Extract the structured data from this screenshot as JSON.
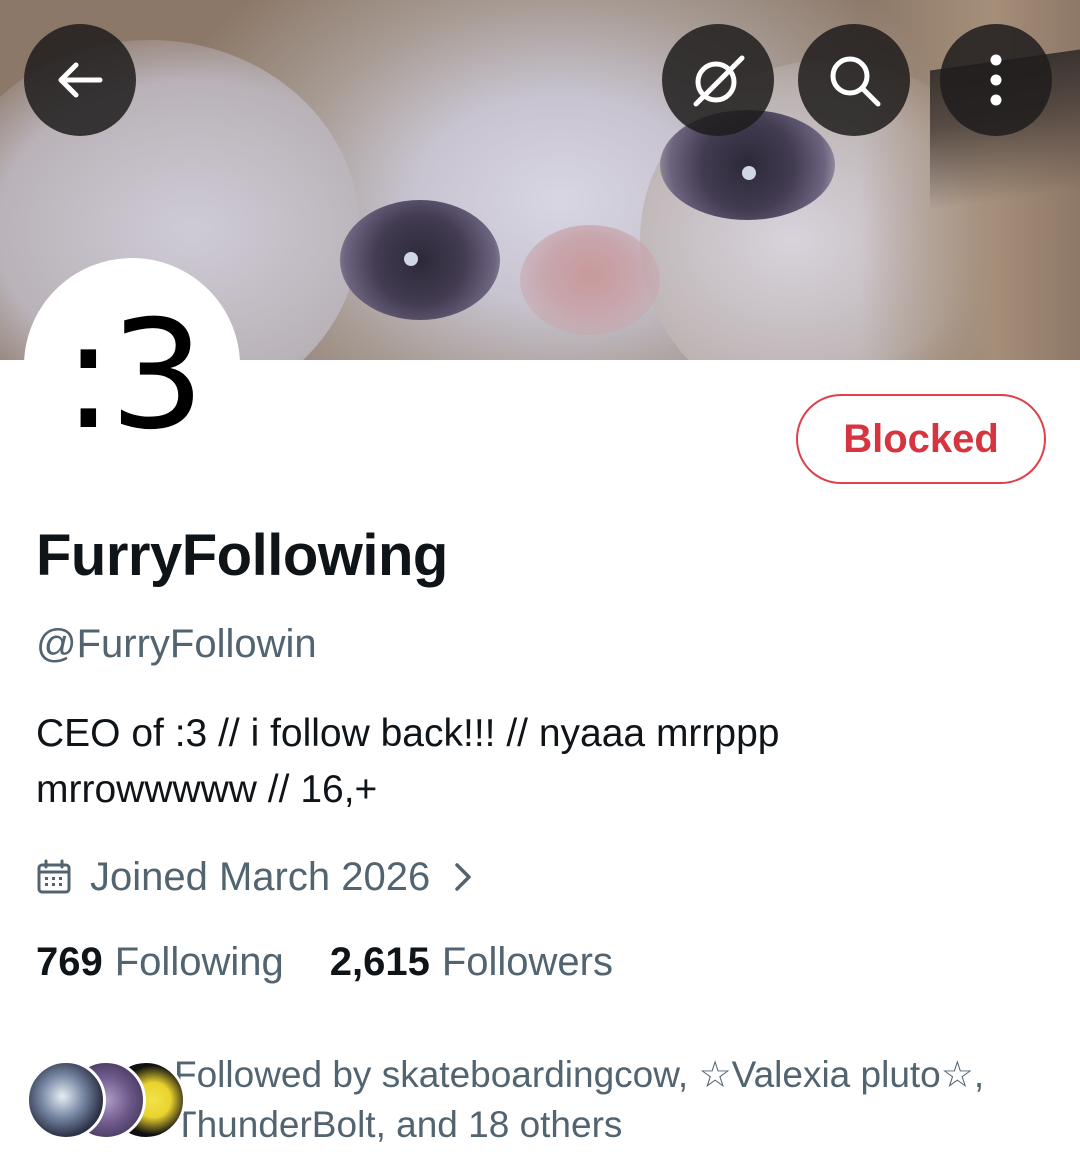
{
  "header": {
    "back_icon": "arrow-left-icon",
    "grok_icon": "grok-icon",
    "search_icon": "search-icon",
    "more_icon": "more-vertical-icon"
  },
  "profile": {
    "avatar_text": ":3",
    "action_button": "Blocked",
    "display_name": "FurryFollowing",
    "handle": "@FurryFollowin",
    "bio_line1": "CEO of :3 // i follow back!!! // nyaaa mrrppp",
    "bio_line2": "mrrowwwww // 16,+",
    "joined": "Joined March 2026",
    "following_count": "769",
    "following_label": "Following",
    "followers_count": "2,615",
    "followers_label": "Followers",
    "followed_by_line1": "Followed by skateboardingcow, ☆Valexia pluto☆,",
    "followed_by_line2": "ThunderBolt, and 18 others"
  },
  "colors": {
    "blocked": "#d6343f",
    "secondary_text": "#536471",
    "primary_text": "#0f1419"
  }
}
